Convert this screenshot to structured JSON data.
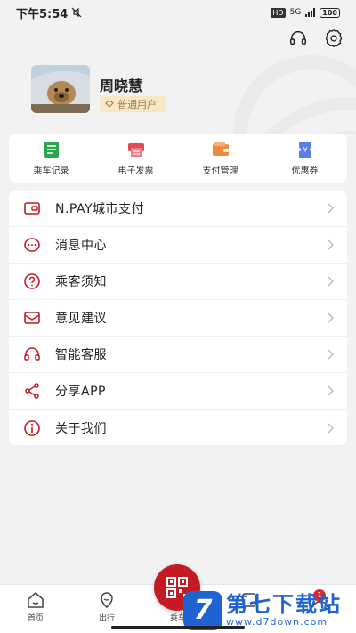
{
  "status_bar": {
    "time": "下午5:54",
    "hd": "HD",
    "network": "5G",
    "battery": "100"
  },
  "header_icons": [
    "headset-icon",
    "gear-icon"
  ],
  "profile": {
    "name": "周晓慧",
    "tag": "普通用户"
  },
  "quick_actions": [
    {
      "label": "乘车记录",
      "icon": "ride-record-icon"
    },
    {
      "label": "电子发票",
      "icon": "invoice-icon"
    },
    {
      "label": "支付管理",
      "icon": "wallet-icon"
    },
    {
      "label": "优惠券",
      "icon": "coupon-icon"
    }
  ],
  "menu": [
    {
      "label": "N.PAY城市支付",
      "icon": "card-icon"
    },
    {
      "label": "消息中心",
      "icon": "message-icon"
    },
    {
      "label": "乘客须知",
      "icon": "question-icon"
    },
    {
      "label": "意见建议",
      "icon": "feedback-icon"
    },
    {
      "label": "智能客服",
      "icon": "headset-icon"
    },
    {
      "label": "分享APP",
      "icon": "share-icon"
    },
    {
      "label": "关于我们",
      "icon": "info-icon"
    }
  ],
  "bottom_nav": [
    {
      "label": "首页",
      "icon": "home-icon"
    },
    {
      "label": "出行",
      "icon": "travel-icon"
    },
    {
      "label": "乘车",
      "icon": "qr-code-icon"
    },
    {
      "label": "",
      "icon": "nav-icon"
    },
    {
      "label": "",
      "icon": "profile-icon"
    }
  ],
  "colors": {
    "accent": "#c41a23",
    "background": "#f2f2f2",
    "tag_bg": "#f6e7c6",
    "tag_text": "#a17a3b"
  },
  "watermark": {
    "title": "第七下载站",
    "url": "www.d7down.com",
    "logo_char": "7",
    "badge": "1"
  }
}
